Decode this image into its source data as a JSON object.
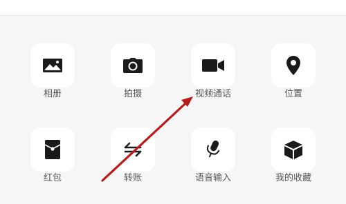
{
  "panel": {
    "items": [
      {
        "label": "相册",
        "icon": "photo-album-icon"
      },
      {
        "label": "拍摄",
        "icon": "camera-icon"
      },
      {
        "label": "视频通话",
        "icon": "video-call-icon"
      },
      {
        "label": "位置",
        "icon": "location-pin-icon"
      },
      {
        "label": "红包",
        "icon": "red-packet-icon"
      },
      {
        "label": "转账",
        "icon": "transfer-icon"
      },
      {
        "label": "语音输入",
        "icon": "microphone-icon"
      },
      {
        "label": "我的收藏",
        "icon": "favorites-box-icon"
      }
    ]
  },
  "colors": {
    "background": "#f6f6f6",
    "tile": "#ffffff",
    "icon": "#1a1a1a",
    "label": "#555555",
    "annotation_arrow": "#b71c1c"
  }
}
